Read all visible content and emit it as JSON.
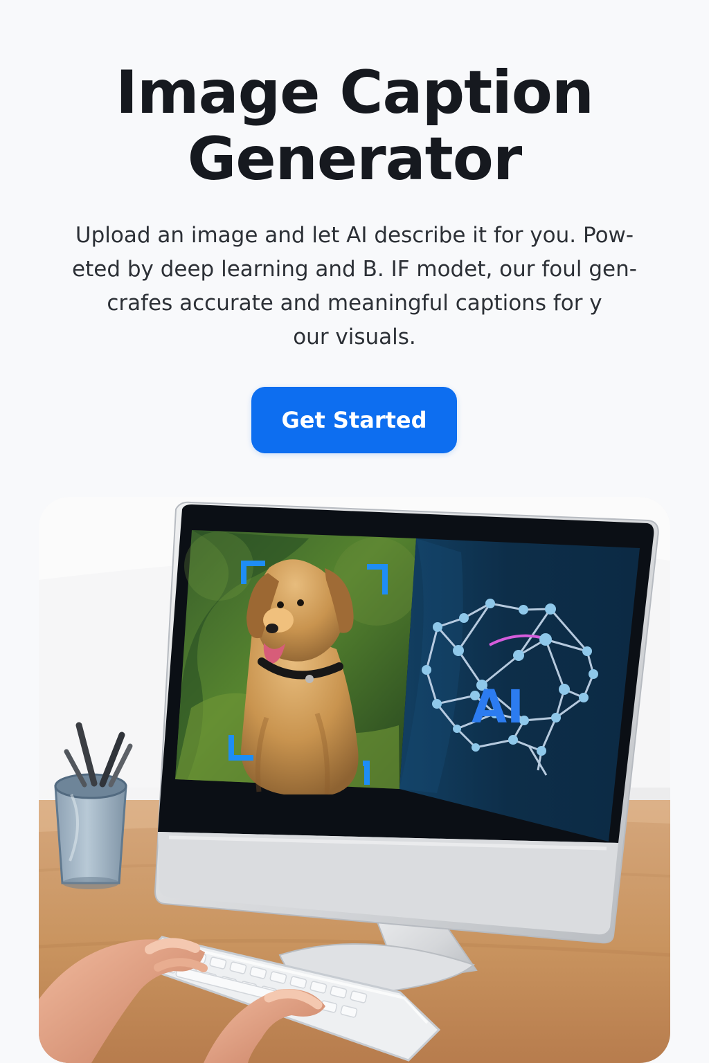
{
  "hero": {
    "title": "Image Caption Generator",
    "title_lines": [
      "Image Caption",
      "Generator"
    ],
    "subtitle_lines": [
      "Upload an image and let AI describe it for you. Pow-",
      "eted by deep learning and B. IF modet, our foul gen-",
      "crafes accurate and meaningful captions for y",
      "our visuals."
    ],
    "cta_label": "Get Started"
  },
  "illustration": {
    "monitor_label": "AI",
    "scene": "desktop computer showing a dog photo with focus brackets and an AI brain network"
  },
  "colors": {
    "background": "#f8f9fb",
    "title": "#16191f",
    "cta": "#0d6ef0",
    "monitor_ai": "#2c7cf0",
    "focus_bracket": "#1e8df5"
  }
}
